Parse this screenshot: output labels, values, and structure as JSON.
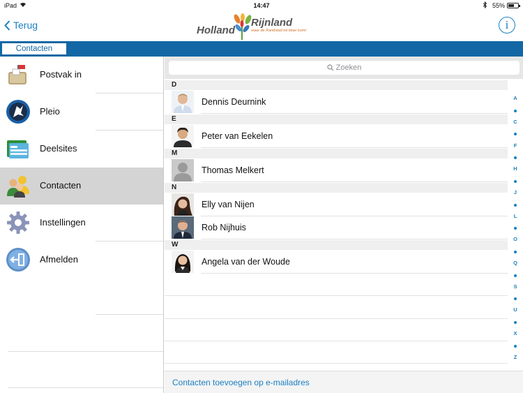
{
  "status": {
    "device": "iPad",
    "time": "14:47",
    "battery": "55%",
    "battery_level": 0.55
  },
  "nav": {
    "back_label": "Terug",
    "logo_left": "Holland",
    "logo_right": "Rijnland",
    "logo_tagline": "waar de Randstad tot bloei komt",
    "info_label": "i"
  },
  "tabbar": {
    "active_tab": "Contacten"
  },
  "sidebar": {
    "items": [
      {
        "label": "Postvak in",
        "icon": "mailbox-icon"
      },
      {
        "label": "Pleio",
        "icon": "pleio-icon"
      },
      {
        "label": "Deelsites",
        "icon": "deelsites-icon"
      },
      {
        "label": "Contacten",
        "icon": "contacts-icon",
        "active": true
      },
      {
        "label": "Instellingen",
        "icon": "gear-icon"
      },
      {
        "label": "Afmelden",
        "icon": "logout-icon"
      }
    ]
  },
  "search": {
    "placeholder": "Zoeken"
  },
  "contacts": {
    "sections": [
      {
        "letter": "D",
        "people": [
          "Dennis Deurnink"
        ]
      },
      {
        "letter": "E",
        "people": [
          "Peter van Eekelen"
        ]
      },
      {
        "letter": "M",
        "people": [
          "Thomas Melkert"
        ]
      },
      {
        "letter": "N",
        "people": [
          "Elly van Nijen",
          "Rob Nijhuis"
        ]
      },
      {
        "letter": "W",
        "people": [
          "Angela van der Woude"
        ]
      }
    ]
  },
  "index": [
    "A",
    "C",
    "F",
    "H",
    "J",
    "L",
    "O",
    "Q",
    "S",
    "U",
    "X",
    "Z"
  ],
  "footer": {
    "add_label": "Contacten toevoegen op e-mailadres"
  },
  "colors": {
    "accent": "#1a7fc1",
    "bar": "#1367a4"
  }
}
